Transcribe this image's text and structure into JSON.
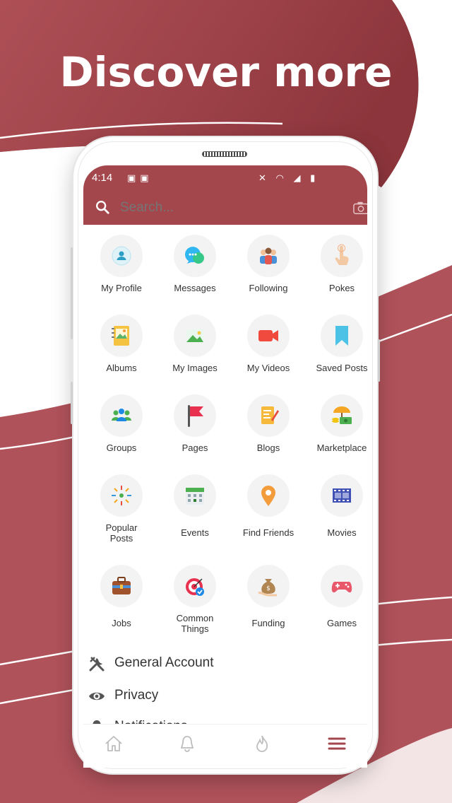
{
  "headline": "Discover more",
  "status": {
    "time": "4:14"
  },
  "search": {
    "placeholder": "Search..."
  },
  "grid_items": [
    {
      "label": "My Profile",
      "icon": "profile-icon"
    },
    {
      "label": "Messages",
      "icon": "messages-icon"
    },
    {
      "label": "Following",
      "icon": "following-icon"
    },
    {
      "label": "Pokes",
      "icon": "pokes-icon"
    },
    {
      "label": "Albums",
      "icon": "albums-icon"
    },
    {
      "label": "My Images",
      "icon": "images-icon"
    },
    {
      "label": "My Videos",
      "icon": "videos-icon"
    },
    {
      "label": "Saved Posts",
      "icon": "bookmark-icon"
    },
    {
      "label": "Groups",
      "icon": "groups-icon"
    },
    {
      "label": "Pages",
      "icon": "flag-icon"
    },
    {
      "label": "Blogs",
      "icon": "blog-icon"
    },
    {
      "label": "Marketplace",
      "icon": "marketplace-icon"
    },
    {
      "label": "Popular Posts",
      "icon": "popular-icon"
    },
    {
      "label": "Events",
      "icon": "calendar-icon"
    },
    {
      "label": "Find Friends",
      "icon": "location-pin-icon"
    },
    {
      "label": "Movies",
      "icon": "film-icon"
    },
    {
      "label": "Jobs",
      "icon": "briefcase-icon"
    },
    {
      "label": "Common Things",
      "icon": "target-icon"
    },
    {
      "label": "Funding",
      "icon": "money-bag-icon"
    },
    {
      "label": "Games",
      "icon": "gamepad-icon"
    }
  ],
  "menu": [
    {
      "label": "General Account",
      "icon": "tools-icon"
    },
    {
      "label": "Privacy",
      "icon": "eye-icon"
    },
    {
      "label": "Notifications",
      "icon": "bell-icon"
    }
  ],
  "bottom_nav": [
    {
      "name": "home",
      "icon": "home-icon"
    },
    {
      "name": "notifications",
      "icon": "bell-icon"
    },
    {
      "name": "trending",
      "icon": "flame-icon"
    },
    {
      "name": "menu",
      "icon": "hamburger-icon"
    }
  ],
  "colors": {
    "brand": "#a3474d",
    "brand_dark": "#8e353c",
    "active": "#a3474d",
    "inactive": "#bdbdbd"
  }
}
